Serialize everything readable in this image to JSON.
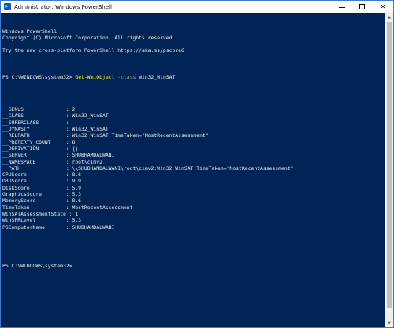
{
  "window": {
    "title": "Administrator: Windows PowerShell",
    "icon": "powershell-icon",
    "icon_glyph": ">",
    "controls": {
      "minimize": "minimize-icon",
      "maximize": "maximize-icon",
      "close_glyph": "✕"
    }
  },
  "console": {
    "background": "#012456",
    "foreground": "#eeedf0",
    "banner": [
      "Windows PowerShell",
      "Copyright (C) Microsoft Corporation. All rights reserved.",
      "",
      "Try the new cross-platform PowerShell https://aka.ms/pscore6",
      ""
    ],
    "command": {
      "prompt": "PS C:\\WINDOWS\\system32> ",
      "cmdlet": "Get-WmiObject",
      "param": " -class",
      "arg": " Win32_WinSAT"
    },
    "output": [
      "",
      "",
      "__GENUS              : 2",
      "__CLASS              : Win32_WinSAT",
      "__SUPERCLASS         :",
      "__DYNASTY            : Win32_WinSAT",
      "__RELPATH            : Win32_WinSAT.TimeTaken=\"MostRecentAssessment\"",
      "__PROPERTY_COUNT     : 8",
      "__DERIVATION         : {}",
      "__SERVER             : SHUBHAMDALWANI",
      "__NAMESPACE          : root\\cimv2",
      "__PATH               : \\\\SHUBHAMDALWANI\\root\\cimv2:Win32_WinSAT.TimeTaken=\"MostRecentAssessment\"",
      "CPUScore             : 8.6",
      "D3DScore             : 9.9",
      "DiskScore            : 5.9",
      "GraphicsScore        : 5.3",
      "MemoryScore          : 8.6",
      "TimeTaken            : MostRecentAssessment",
      "WinSATAssessmentState : 1",
      "WinSPRLevel          : 5.3",
      "PSComputerName       : SHUBHAMDALWANI",
      "",
      "",
      ""
    ],
    "final_prompt": "PS C:\\WINDOWS\\system32>"
  },
  "scrollbar": {
    "up_glyph": "▲",
    "down_glyph": "▼"
  }
}
